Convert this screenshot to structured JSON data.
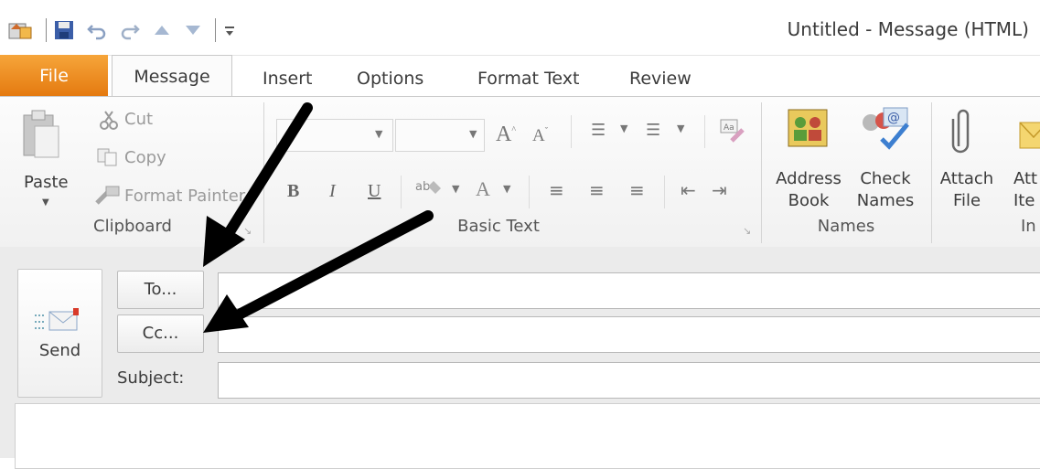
{
  "window": {
    "title": "Untitled  -  Message (HTML)"
  },
  "tabs": {
    "file": "File",
    "items": [
      "Message",
      "Insert",
      "Options",
      "Format Text",
      "Review"
    ],
    "active": "Message"
  },
  "ribbon": {
    "clipboard": {
      "paste_label": "Paste",
      "cut_label": "Cut",
      "copy_label": "Copy",
      "format_painter_label": "Format Painter",
      "group_label": "Clipboard"
    },
    "basic_text": {
      "group_label": "Basic Text",
      "bold": "B",
      "italic": "I",
      "underline": "U"
    },
    "names": {
      "address_book_line1": "Address",
      "address_book_line2": "Book",
      "check_names_line1": "Check",
      "check_names_line2": "Names",
      "group_label": "Names"
    },
    "include": {
      "attach_file_line1": "Attach",
      "attach_file_line2": "File",
      "attach_item_line1": "Att",
      "attach_item_line2": "Ite",
      "group_label": "In"
    }
  },
  "compose": {
    "send_label": "Send",
    "to_label": "To...",
    "cc_label": "Cc...",
    "subject_label": "Subject:",
    "to_value": "",
    "cc_value": "",
    "subject_value": ""
  },
  "colors": {
    "file_tab": "#e4790f",
    "ribbon_bg": "#f1f1f1",
    "compose_bg": "#ebebeb"
  }
}
